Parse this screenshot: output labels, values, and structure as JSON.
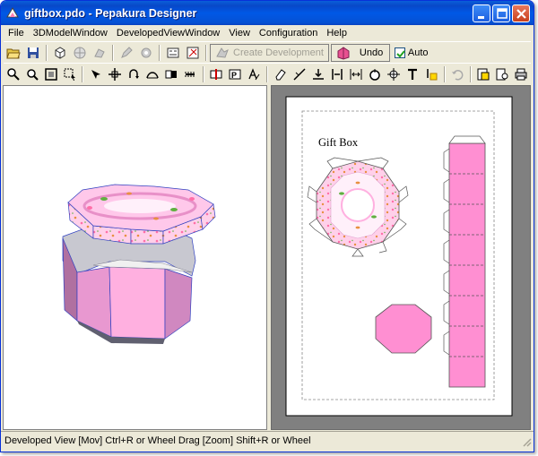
{
  "window": {
    "title": "giftbox.pdo - Pepakura Designer"
  },
  "menu": [
    "File",
    "3DModelWindow",
    "DevelopedViewWindow",
    "View",
    "Configuration",
    "Help"
  ],
  "toolbar": {
    "create_development_label": "Create Development",
    "undo_label": "Undo",
    "auto_label": "Auto",
    "auto_checked": true
  },
  "canvas": {
    "gift_box_label": "Gift Box"
  },
  "status": {
    "text": "Developed View [Mov] Ctrl+R or Wheel Drag [Zoom] Shift+R or Wheel"
  },
  "colors": {
    "accent": "#0054e3",
    "pink": "#ff8fd2",
    "titlebar": "#0058e6"
  }
}
